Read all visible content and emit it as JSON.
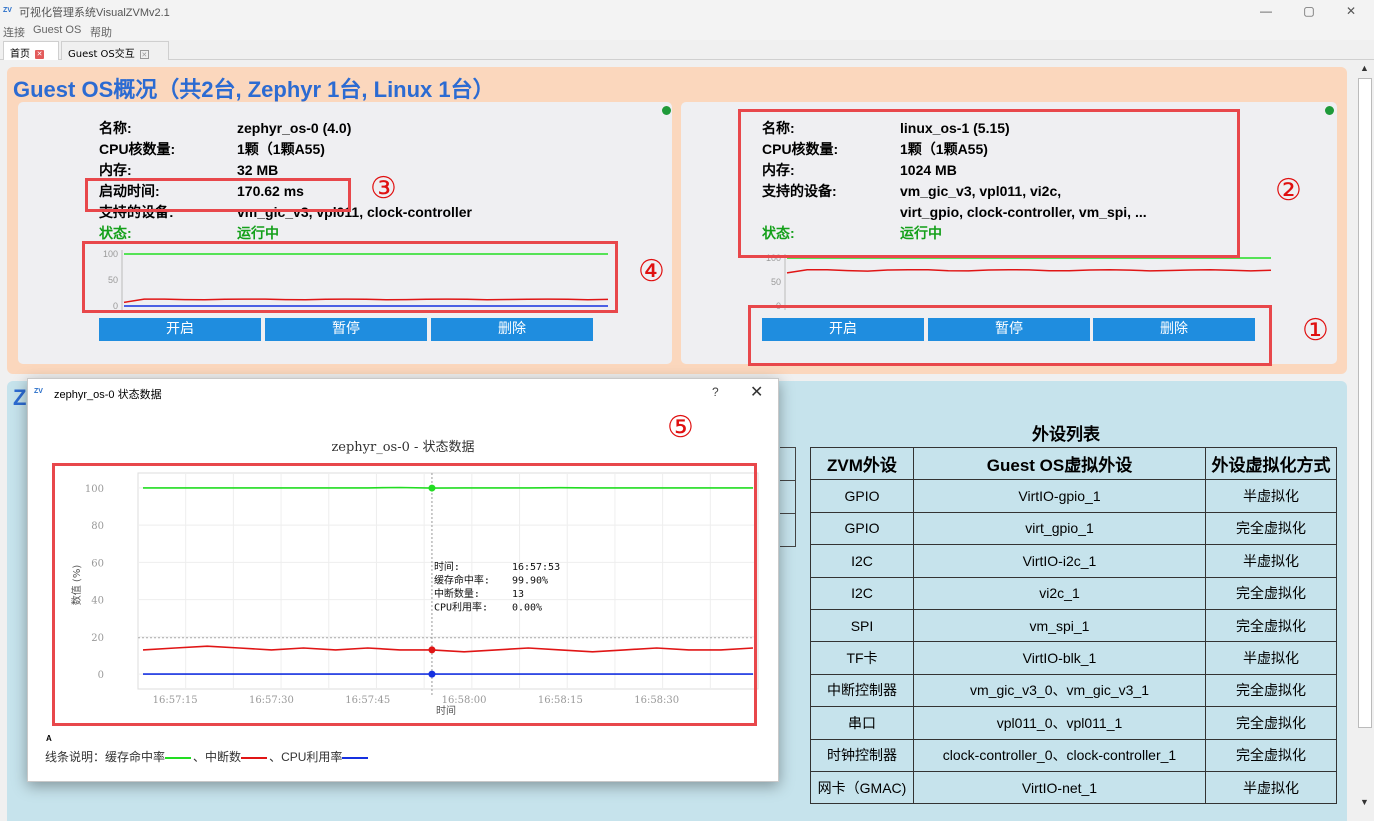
{
  "window": {
    "title": "可视化管理系统VisualZVMv2.1",
    "controls": [
      "—",
      "▢",
      "✕"
    ]
  },
  "menu": [
    "连接",
    "Guest OS",
    "帮助"
  ],
  "tabs": [
    {
      "label": "首页",
      "active": true
    },
    {
      "label": "Guest OS交互",
      "active": false
    }
  ],
  "overview": {
    "title": "Guest OS概况（共2台, Zephyr 1台, Linux 1台）",
    "cards": [
      {
        "rows": [
          {
            "key": "名称:",
            "value": "zephyr_os-0 (4.0)"
          },
          {
            "key": "CPU核数量:",
            "value": "1颗（1颗A55)"
          },
          {
            "key": "内存:",
            "value": "32 MB"
          },
          {
            "key": "启动时间:",
            "value": "170.62 ms"
          },
          {
            "key": "支持的设备:",
            "value": "vm_gic_v3, vpl011, clock-controller"
          },
          {
            "key": "状态:",
            "value": "运行中"
          }
        ],
        "chart": {
          "ticks": [
            "100",
            "50",
            "0"
          ],
          "cache_hit": 100,
          "interrupts": 13,
          "cpu": 0
        },
        "buttons": [
          "开启",
          "暂停",
          "删除"
        ],
        "status_color": "#1f9a3a"
      },
      {
        "rows": [
          {
            "key": "名称:",
            "value": "linux_os-1 (5.15)"
          },
          {
            "key": "CPU核数量:",
            "value": "1颗（1颗A55)"
          },
          {
            "key": "内存:",
            "value": "1024 MB"
          },
          {
            "key": "支持的设备:",
            "value": "vm_gic_v3, vpl011, vi2c,"
          },
          {
            "key": "",
            "value": "virt_gpio, clock-controller, vm_spi, ..."
          },
          {
            "key": "状态:",
            "value": "运行中"
          }
        ],
        "chart": {
          "ticks": [
            "100",
            "50",
            "0"
          ],
          "cache_hit": 100,
          "interrupts": 75,
          "cpu": 0
        },
        "buttons": [
          "开启",
          "暂停",
          "删除"
        ],
        "status_color": "#1f9a3a"
      }
    ]
  },
  "markers": [
    "①",
    "②",
    "③",
    "④",
    "⑤"
  ],
  "lower": {
    "title_prefix": "Z",
    "table_title": "外设列表",
    "headers": [
      "ZVM外设",
      "Guest OS虚拟外设",
      "外设虚拟化方式"
    ],
    "rows": [
      [
        "GPIO",
        "VirtIO-gpio_1",
        "半虚拟化"
      ],
      [
        "GPIO",
        "virt_gpio_1",
        "完全虚拟化"
      ],
      [
        "I2C",
        "VirtIO-i2c_1",
        "半虚拟化"
      ],
      [
        "I2C",
        "vi2c_1",
        "完全虚拟化"
      ],
      [
        "SPI",
        "vm_spi_1",
        "完全虚拟化"
      ],
      [
        "TF卡",
        "VirtIO-blk_1",
        "半虚拟化"
      ],
      [
        "中断控制器",
        "vm_gic_v3_0、vm_gic_v3_1",
        "完全虚拟化"
      ],
      [
        "串口",
        "vpl011_0、vpl011_1",
        "完全虚拟化"
      ],
      [
        "时钟控制器",
        "clock-controller_0、clock-controller_1",
        "完全虚拟化"
      ],
      [
        "网卡（GMAC)",
        "VirtIO-net_1",
        "半虚拟化"
      ]
    ]
  },
  "dialog": {
    "title": "zephyr_os-0 状态数据",
    "help": "?",
    "close": "✕",
    "chart_title": "zephyr_os-0 - 状态数据",
    "legend_mark": "A",
    "legend": {
      "prefix": "线条说明：",
      "items": [
        {
          "name": "缓存命中率",
          "color": "#22dd22",
          "sep": "、"
        },
        {
          "name": "中断数",
          "color": "#e01515",
          "sep": "、"
        },
        {
          "name": "CPU利用率",
          "color": "#1530e0",
          "sep": ""
        }
      ]
    },
    "tooltip": [
      {
        "k": "时间:",
        "v": "16:57:53"
      },
      {
        "k": "缓存命中率:",
        "v": "99.90%"
      },
      {
        "k": "中断数量:",
        "v": "13"
      },
      {
        "k": "CPU利用率:",
        "v": "0.00%"
      }
    ]
  },
  "chart_data": {
    "type": "line",
    "title": "zephyr_os-0 - 状态数据",
    "xlabel": "时间",
    "ylabel": "数值 (%)",
    "ylim": [
      -8,
      108
    ],
    "yticks": [
      0,
      20,
      40,
      60,
      80,
      100
    ],
    "x": [
      "16:57:09",
      "16:57:15",
      "16:57:20",
      "16:57:25",
      "16:57:30",
      "16:57:35",
      "16:57:40",
      "16:57:45",
      "16:57:50",
      "16:57:53",
      "16:58:00",
      "16:58:05",
      "16:58:10",
      "16:58:15",
      "16:58:20",
      "16:58:25",
      "16:58:30",
      "16:58:35",
      "16:58:40",
      "16:58:45"
    ],
    "xticks": [
      "16:57:15",
      "16:57:30",
      "16:57:45",
      "16:58:00",
      "16:58:15",
      "16:58:30"
    ],
    "highlight_x": "16:57:53",
    "series": [
      {
        "name": "缓存命中率",
        "color": "#22dd22",
        "values": [
          100,
          100,
          100,
          100,
          100,
          100,
          100,
          100,
          100.2,
          99.9,
          100,
          100,
          100,
          100.1,
          100,
          100,
          100,
          100,
          100,
          100
        ]
      },
      {
        "name": "中断数",
        "color": "#e01515",
        "values": [
          13,
          14,
          15,
          14,
          13,
          14,
          13,
          14,
          13,
          13,
          12,
          13,
          14,
          13,
          12,
          13,
          14,
          13,
          13,
          14
        ]
      },
      {
        "name": "CPU利用率",
        "color": "#1530e0",
        "values": [
          0,
          0,
          0,
          0,
          0,
          0,
          0,
          0,
          0,
          0,
          0,
          0,
          0,
          0,
          0,
          0,
          0,
          0,
          0,
          0
        ]
      }
    ],
    "grid": true
  }
}
